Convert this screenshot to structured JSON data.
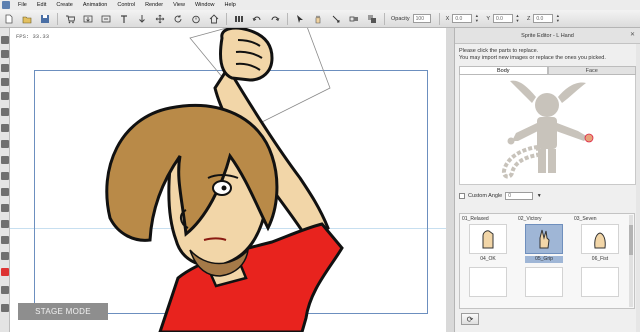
{
  "menubar": {
    "items": [
      "File",
      "Edit",
      "Create",
      "Animation",
      "Control",
      "Render",
      "View",
      "Window",
      "Help"
    ]
  },
  "toolbar": {
    "opacity_label": "Opacity",
    "opacity_value": "100",
    "x_label": "X",
    "x_value": "0.0",
    "y_label": "Y",
    "y_value": "0.0",
    "z_label": "Z",
    "z_value": "0.0"
  },
  "stage": {
    "fps": "FPS: 33.33",
    "stage_mode_label": "STAGE MODE"
  },
  "panel": {
    "title": "Sprite Editor - L Hand",
    "close_glyph": "✕",
    "instructions_line1": "Please click the parts to replace.",
    "instructions_line2": "You may import new images or replace the ones you picked.",
    "tabs": [
      {
        "label": "Body",
        "active": true
      },
      {
        "label": "Face",
        "active": false
      }
    ],
    "custom_angle_label": "Custom Angle",
    "custom_angle_value": "0",
    "sprites_row1": [
      "01_Relaxed",
      "02_Victory",
      "03_Seven"
    ],
    "sprites_row2": [
      "04_OK",
      "05_Grip",
      "06_Fist"
    ],
    "selected_sprite": "05_Grip",
    "refresh_glyph": "⟳"
  },
  "colors": {
    "stage_frame": "#6c8fbf",
    "shirt": "#e8231e",
    "hair": "#b98a48",
    "skin": "#f2d6a8",
    "selection": "#9fb6d6"
  }
}
